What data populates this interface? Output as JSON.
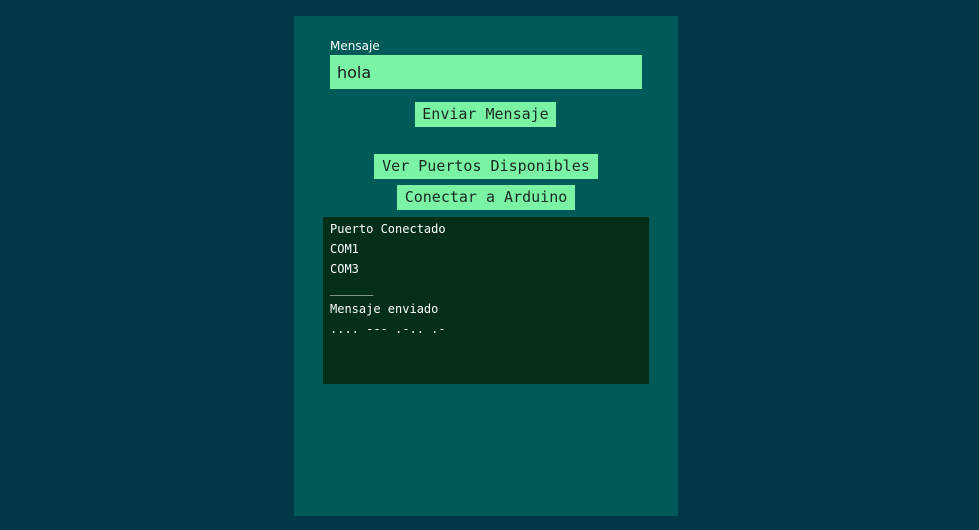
{
  "form": {
    "message_label": "Mensaje",
    "message_value": "hola"
  },
  "buttons": {
    "send": "Enviar Mensaje",
    "list_ports": "Ver Puertos Disponibles",
    "connect": "Conectar a Arduino"
  },
  "console": {
    "lines": [
      "Puerto Conectado",
      "COM1",
      "COM3",
      "______",
      "Mensaje enviado",
      ".... --- .-.. .-"
    ]
  },
  "colors": {
    "background": "#003845",
    "panel": "#005a58",
    "accent": "#7bf3a4",
    "console_bg": "#032e18"
  }
}
